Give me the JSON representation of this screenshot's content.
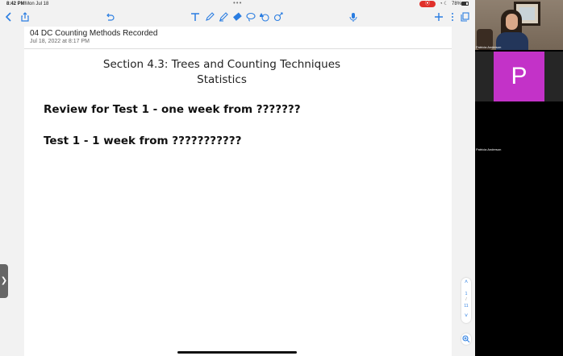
{
  "status_bar": {
    "time": "8:42 PM",
    "date": "Mon Jul 18",
    "multitask_dots": "•••",
    "recording_icon": "record-icon",
    "battery_percent": "78%"
  },
  "toolbar": {
    "icons": [
      "back-chevron-icon",
      "share-icon",
      "undo-icon",
      "text-tool-icon",
      "pen-icon",
      "highlighter-icon",
      "eraser-icon",
      "lasso-icon",
      "shapes-icon",
      "image-icon",
      "microphone-icon",
      "add-page-icon",
      "more-icon",
      "pages-icon"
    ],
    "accent_color": "#2a7de1"
  },
  "document": {
    "title": "04 DC Counting Methods Recorded",
    "date": "Jul 18, 2022 at 8:17 PM"
  },
  "slide": {
    "title_line1": "Section 4.3:  Trees and Counting Techniques",
    "title_line2": "Statistics",
    "line1": "Review for Test 1 - one week from ???????",
    "line2": "Test 1 - 1 week from ???????????"
  },
  "page_nav": {
    "current": "1",
    "separator": "/",
    "total": "11"
  },
  "participants": [
    {
      "name": "Patricia Anderson",
      "type": "video"
    },
    {
      "name": "Patricia Anderson",
      "initial": "P",
      "avatar_color": "#c332c8"
    }
  ]
}
